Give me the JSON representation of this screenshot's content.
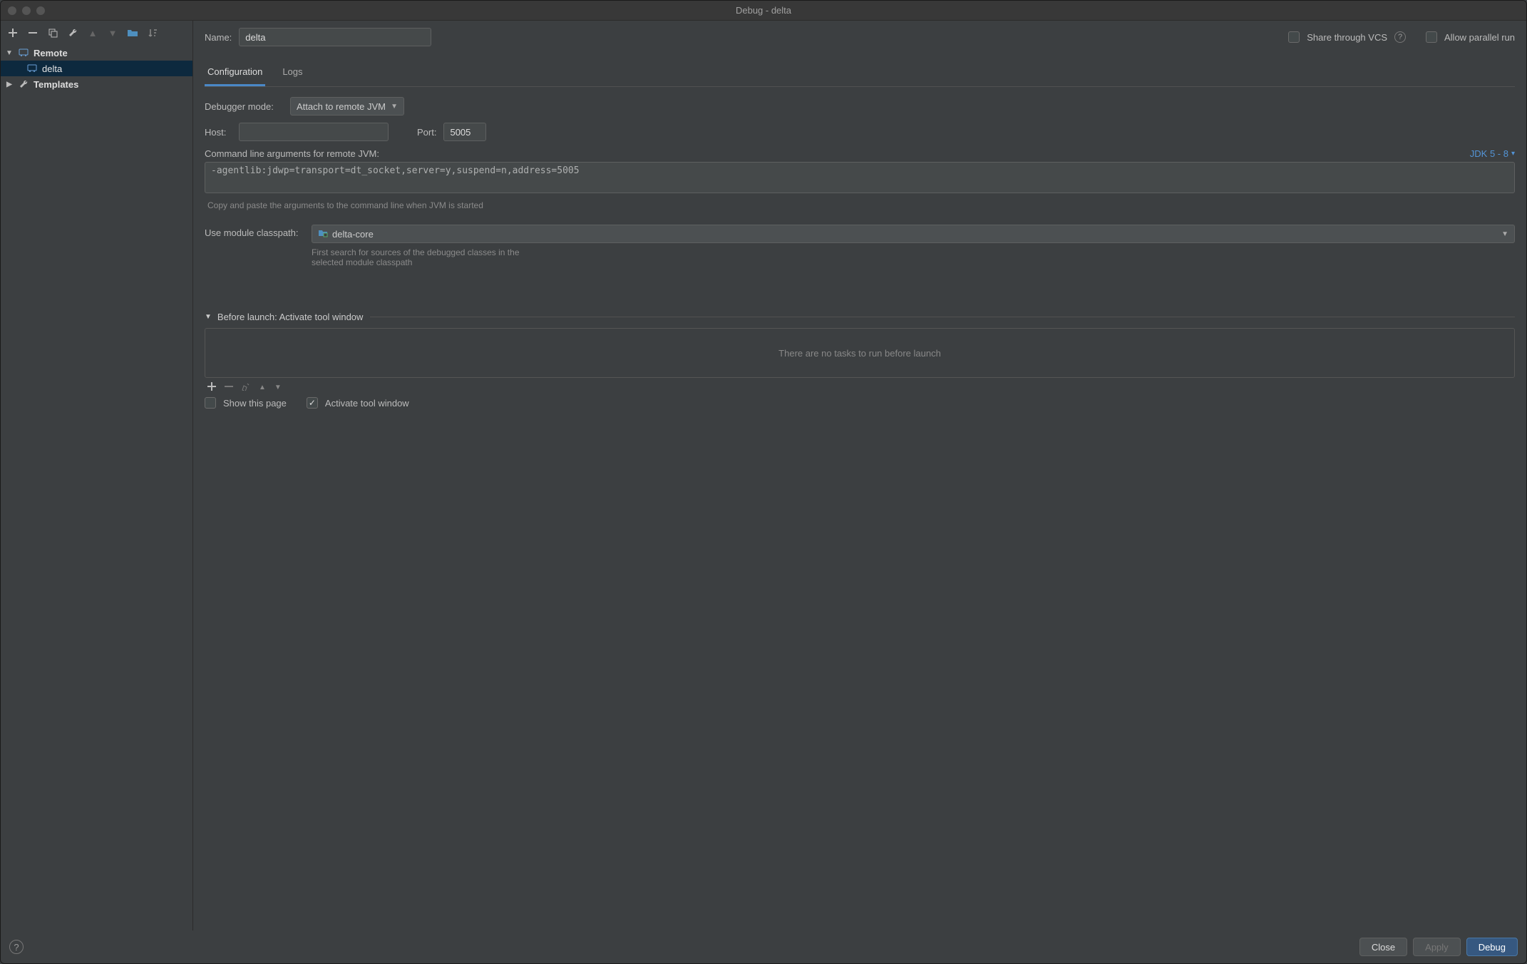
{
  "window": {
    "title": "Debug - delta"
  },
  "sidebar": {
    "remote": "Remote",
    "config_name": "delta",
    "templates": "Templates"
  },
  "form": {
    "name_label": "Name:",
    "name_value": "delta",
    "share_label": "Share through VCS",
    "allow_parallel_label": "Allow parallel run"
  },
  "tabs": {
    "configuration": "Configuration",
    "logs": "Logs"
  },
  "config": {
    "debugger_mode_label": "Debugger mode:",
    "debugger_mode_value": "Attach to remote JVM",
    "host_label": "Host:",
    "host_value": "",
    "port_label": "Port:",
    "port_value": "5005",
    "cmd_args_label": "Command line arguments for remote JVM:",
    "jdk_label": "JDK 5 - 8",
    "cmd_args_value": "-agentlib:jdwp=transport=dt_socket,server=y,suspend=n,address=5005",
    "copy_hint": "Copy and paste the arguments to the command line when JVM is started",
    "module_label": "Use module classpath:",
    "module_value": "delta-core",
    "module_hint": "First search for sources of the debugged classes in the selected module classpath",
    "before_header": "Before launch: Activate tool window",
    "before_empty": "There are no tasks to run before launch",
    "show_page": "Show this page",
    "activate_tool": "Activate tool window"
  },
  "footer": {
    "close": "Close",
    "apply": "Apply",
    "debug": "Debug"
  }
}
